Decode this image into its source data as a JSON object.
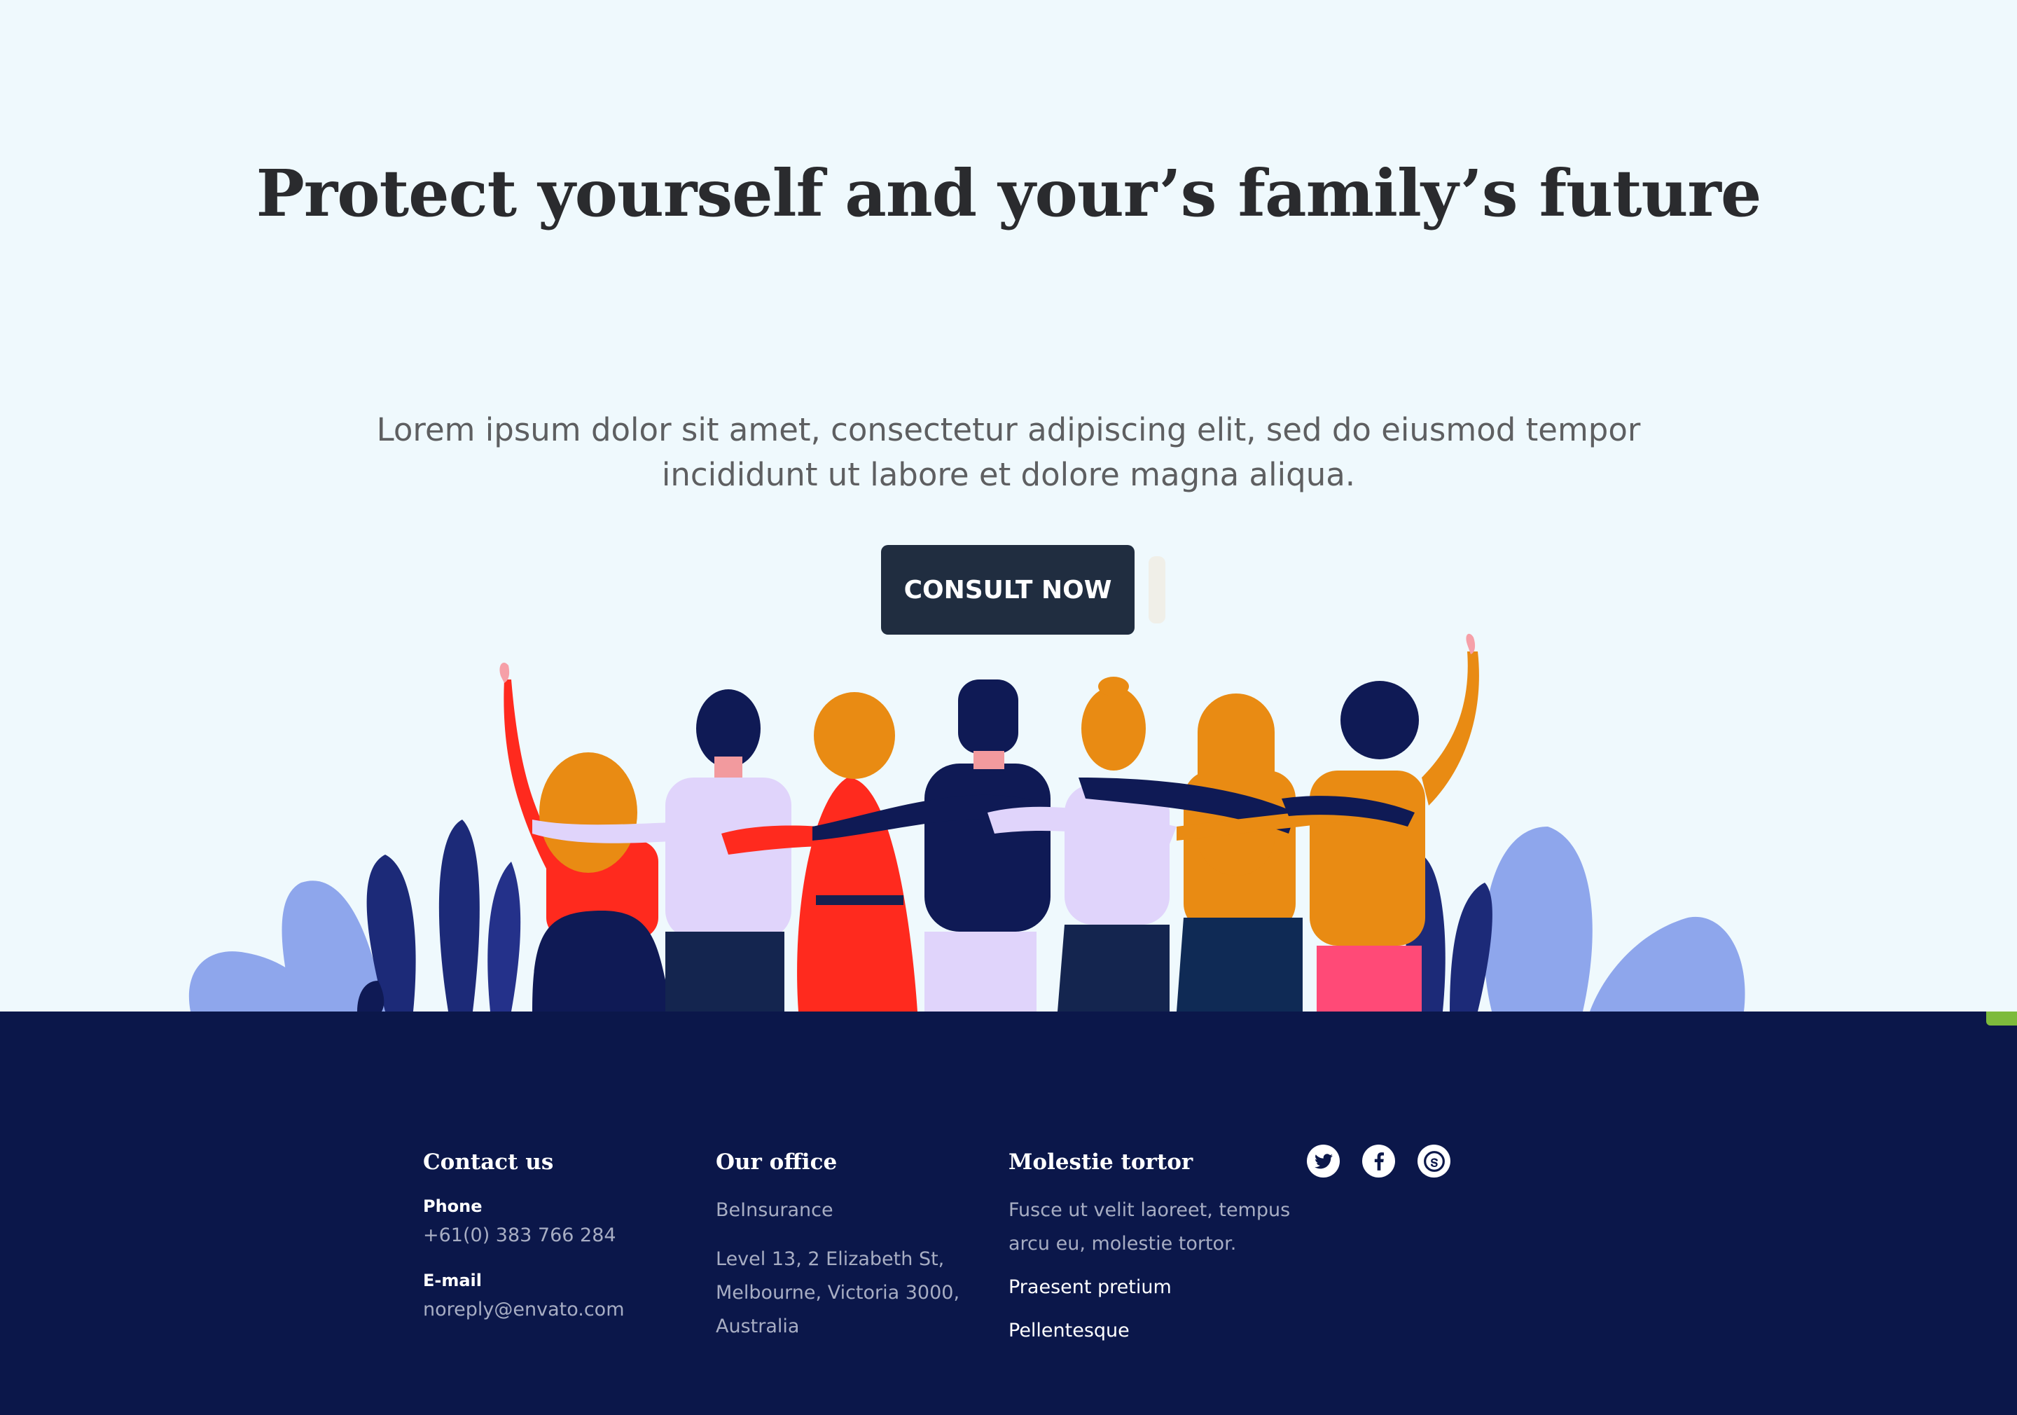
{
  "hero": {
    "title": "Protect yourself and your’s family’s future",
    "text": "Lorem ipsum dolor sit amet, consectetur adipiscing elit, sed do eiusmod tempor incididunt ut labore et dolore magna aliqua.",
    "cta_label": "CONSULT NOW"
  },
  "footer": {
    "contact": {
      "title": "Contact us",
      "phone_label": "Phone",
      "phone": "+61(0) 383 766 284",
      "email_label": "E-mail",
      "email": "noreply@envato.com"
    },
    "office": {
      "title": "Our office",
      "company": "BeInsurance",
      "address_line1": "Level 13, 2 Elizabeth St,",
      "address_line2": "Melbourne, Victoria 3000,",
      "address_line3": "Australia"
    },
    "links": {
      "title": "Molestie tortor",
      "description_line1": "Fusce ut velit laoreet, tempus",
      "description_line2": "arcu eu, molestie tortor.",
      "link1": "Praesent pretium",
      "link2": "Pellentesque"
    },
    "social": [
      {
        "icon": "twitter-icon"
      },
      {
        "icon": "facebook-icon"
      },
      {
        "icon": "skype-icon"
      }
    ]
  },
  "colors": {
    "hero_bg": "#eff9fd",
    "footer_bg": "#0b174a",
    "button_bg": "#202d40",
    "heading": "#2a2b2e",
    "body_text": "#5e5f61",
    "accent": "#7dbb3c"
  }
}
